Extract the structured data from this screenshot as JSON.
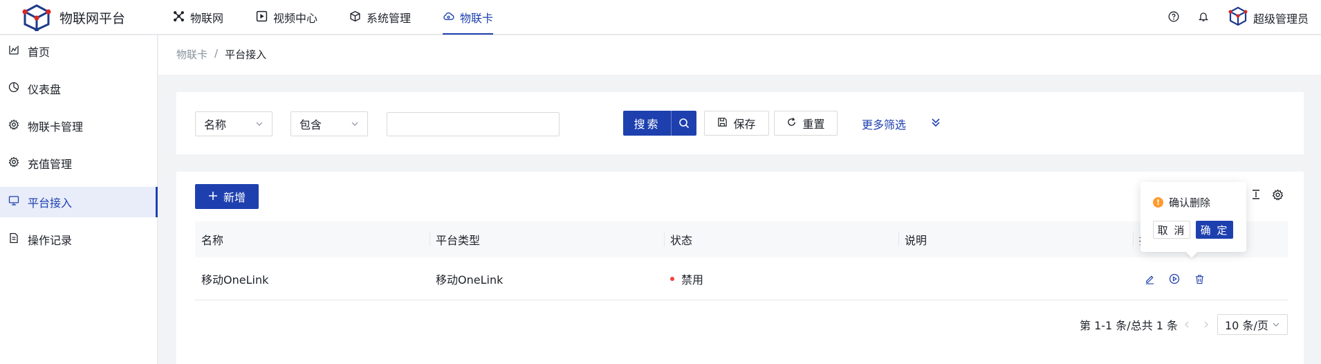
{
  "app": {
    "title": "物联网平台",
    "logo_icon": "cube-logo-icon"
  },
  "topnav": [
    {
      "label": "物联网",
      "icon": "grid-icon",
      "active": false
    },
    {
      "label": "视频中心",
      "icon": "play-square-icon",
      "active": false
    },
    {
      "label": "系统管理",
      "icon": "box-icon",
      "active": false
    },
    {
      "label": "物联卡",
      "icon": "cloud-icon",
      "active": true
    }
  ],
  "user": {
    "name": "超级管理员",
    "help_icon": "help-icon",
    "bell_icon": "bell-icon"
  },
  "sidebar": {
    "items": [
      {
        "label": "首页",
        "icon": "chart-icon"
      },
      {
        "label": "仪表盘",
        "icon": "pie-icon"
      },
      {
        "label": "物联卡管理",
        "icon": "gear-icon"
      },
      {
        "label": "充值管理",
        "icon": "gear-icon"
      },
      {
        "label": "平台接入",
        "icon": "monitor-icon",
        "active": true
      },
      {
        "label": "操作记录",
        "icon": "log-icon"
      }
    ]
  },
  "breadcrumb": {
    "parent": "物联卡",
    "separator": "/",
    "current": "平台接入"
  },
  "filter": {
    "field_select": "名称",
    "operator_select": "包含",
    "value": "",
    "search_label": "搜索",
    "save_label": "保存",
    "reset_label": "重置",
    "more_label": "更多筛选"
  },
  "table": {
    "add_label": "新增",
    "columns": [
      "名称",
      "平台类型",
      "状态",
      "说明",
      "操作"
    ],
    "rows": [
      {
        "name": "移动OneLink",
        "platform": "移动OneLink",
        "status": "禁用",
        "description": ""
      }
    ],
    "colors": {
      "primary": "#1e40af",
      "status_disabled": "#f53f3f",
      "warning": "#ff9a2e"
    }
  },
  "pagination": {
    "summary": "第 1-1 条/总共 1 条",
    "page_size": "10 条/页"
  },
  "popconfirm": {
    "title": "确认删除",
    "cancel": "取 消",
    "ok": "确 定"
  }
}
